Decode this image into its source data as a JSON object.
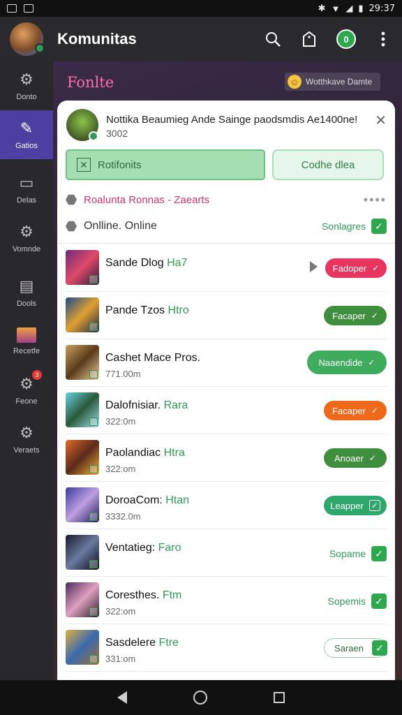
{
  "status": {
    "time": "29:37"
  },
  "appbar": {
    "title": "Komunitas"
  },
  "rail": [
    {
      "label": "Donto",
      "icon": "gear-icon",
      "active": false
    },
    {
      "label": "Gatios",
      "icon": "pin-icon",
      "active": true
    },
    {
      "label": "Delas",
      "icon": "picture-icon",
      "active": false
    },
    {
      "label": "Vomnde",
      "icon": "gear-icon",
      "active": false
    },
    {
      "label": "Dools",
      "icon": "document-icon",
      "active": false
    },
    {
      "label": "Recetfe",
      "icon": "image-icon",
      "active": false
    },
    {
      "label": "Feone",
      "icon": "gear-icon",
      "active": false,
      "badge": "3"
    },
    {
      "label": "Veraets",
      "icon": "gear-icon",
      "active": false
    }
  ],
  "hero": {
    "title": "Fonlte",
    "pill_label": "Wotthkave Damte"
  },
  "sheet": {
    "message": "Nottika Beaumieg Ande Saingе paodsmdis Ae1400ne!",
    "sub": "3002",
    "primary_button": "Rotifonits",
    "secondary_button": "Codhe dlea",
    "section_title": "Roalunta Ronnas - Zaearts",
    "online_label": "Onlline. Online",
    "online_status": "Sonlagres"
  },
  "list": [
    {
      "name": "Sande Dlog",
      "highlight": "Ha7",
      "sub": "",
      "action": "Fadoper",
      "style": "red",
      "play": true
    },
    {
      "name": "Pande Tzos",
      "highlight": "Htro",
      "sub": "",
      "action": "Facaper",
      "style": "dkgreen"
    },
    {
      "name": "Cashet Mace Pros.",
      "highlight": "",
      "sub": "771.00m",
      "action": "Naaendide",
      "style": "green"
    },
    {
      "name": "Dalofnisiar.",
      "highlight": "Rara",
      "sub": "322:0m",
      "action": "Facaper",
      "style": "orange"
    },
    {
      "name": "Paolandiac",
      "highlight": "Htra",
      "sub": "322:om",
      "action": "Anoaer",
      "style": "dkgreen"
    },
    {
      "name": "DoroaCom:",
      "highlight": "Htan",
      "sub": "3332.0m",
      "action": "Leapper",
      "style": "teal"
    },
    {
      "name": "Ventatieg:",
      "highlight": "Faro",
      "sub": "",
      "action": "Sopame",
      "style": "text"
    },
    {
      "name": "Coresthes.",
      "highlight": "Ftm",
      "sub": "322:om",
      "action": "Sopemis",
      "style": "text"
    },
    {
      "name": "Sasdelere",
      "highlight": "Ftre",
      "sub": "331:om",
      "action": "Saraen",
      "style": "outline"
    }
  ],
  "colors": {
    "accent": "#4b3fa1",
    "green": "#2ea84f",
    "red": "#e8355f",
    "orange": "#ee6a1a",
    "pink_title": "#ff6fa8"
  }
}
